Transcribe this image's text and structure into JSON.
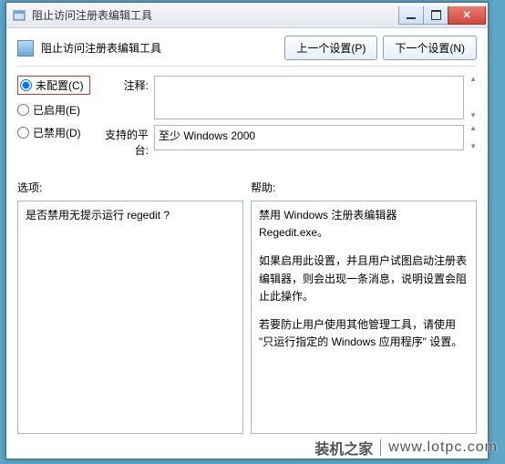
{
  "window": {
    "title": "阻止访问注册表编辑工具"
  },
  "header": {
    "title": "阻止访问注册表编辑工具",
    "prev_btn": "上一个设置(P)",
    "next_btn": "下一个设置(N)"
  },
  "radios": {
    "not_configured": "未配置(C)",
    "enabled": "已启用(E)",
    "disabled": "已禁用(D)"
  },
  "fields": {
    "comment_label": "注释:",
    "comment_value": "",
    "platform_label": "支持的平台:",
    "platform_value": "至少 Windows 2000"
  },
  "sections": {
    "options_label": "选项:",
    "help_label": "帮助:"
  },
  "options": {
    "text": "是否禁用无提示运行 regedit ?"
  },
  "help": {
    "p1": "禁用 Windows 注册表编辑器 Regedit.exe。",
    "p2": "如果启用此设置，并且用户试图启动注册表编辑器，则会出现一条消息，说明设置会阻止此操作。",
    "p3": "若要防止用户使用其他管理工具，请使用 \"只运行指定的 Windows 应用程序\" 设置。"
  },
  "watermark": {
    "name": "装机之家",
    "url": "www.lotpc.com"
  }
}
